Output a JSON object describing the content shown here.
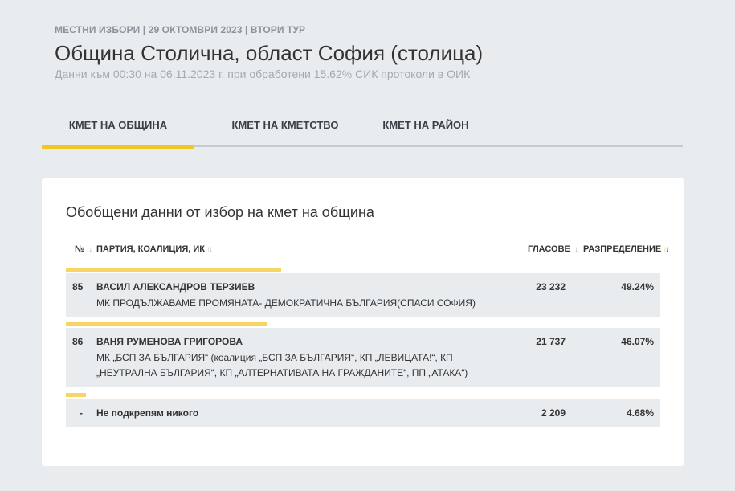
{
  "header": {
    "crumb": "МЕСТНИ ИЗБОРИ | 29 ОКТОМВРИ 2023 | ВТОРИ ТУР",
    "title": "Община Столична, област София (столица)",
    "subtitle": "Данни към 00:30 на 06.11.2023 г. при обработени 15.62% СИК протоколи в ОИК"
  },
  "tabs": [
    {
      "label": "КМЕТ НА ОБЩИНА",
      "active": true
    },
    {
      "label": "КМЕТ НА КМЕТСТВО",
      "active": false
    },
    {
      "label": "КМЕТ НА РАЙОН",
      "active": false
    }
  ],
  "card": {
    "title": "Обобщени данни от избор на кмет на община",
    "columns": {
      "number": "№",
      "party": "ПАРТИЯ, КОАЛИЦИЯ, ИК",
      "votes": "ГЛАСОВЕ",
      "distribution": "РАЗПРЕДЕЛЕНИЕ"
    },
    "rows": [
      {
        "number": "85",
        "candidate": "ВАСИЛ АЛЕКСАНДРОВ ТЕРЗИЕВ",
        "party_line1": "МК ПРОДЪЛЖАВАМЕ ПРОМЯНАТА- ДЕМОКРАТИЧНА БЪЛГАРИЯ(СПАСИ СОФИЯ)",
        "party_line2": "",
        "votes": "23 232",
        "percent": "49.24%",
        "share": 49.24
      },
      {
        "number": "86",
        "candidate": "ВАНЯ РУМЕНОВА ГРИГОРОВА",
        "party_line1": "МК „БСП ЗА БЪЛГАРИЯ“ (коалиция „БСП ЗА БЪЛГАРИЯ“, КП „ЛЕВИЦАТА!“, КП",
        "party_line2": "„НЕУТРАЛНА БЪЛГАРИЯ“, КП „АЛТЕРНАТИВАТА НА ГРАЖДАНИТЕ“, ПП „АТАКА“)",
        "votes": "21 737",
        "percent": "46.07%",
        "share": 46.07
      },
      {
        "number": "-",
        "candidate": "Не подкрепям никого",
        "party_line1": "",
        "party_line2": "",
        "votes": "2 209",
        "percent": "4.68%",
        "share": 4.68
      }
    ]
  },
  "colors": {
    "accent": "#f2c624",
    "bar": "#f7d463",
    "row_bg": "#e8ecef",
    "page_bg": "#e9ecef"
  }
}
